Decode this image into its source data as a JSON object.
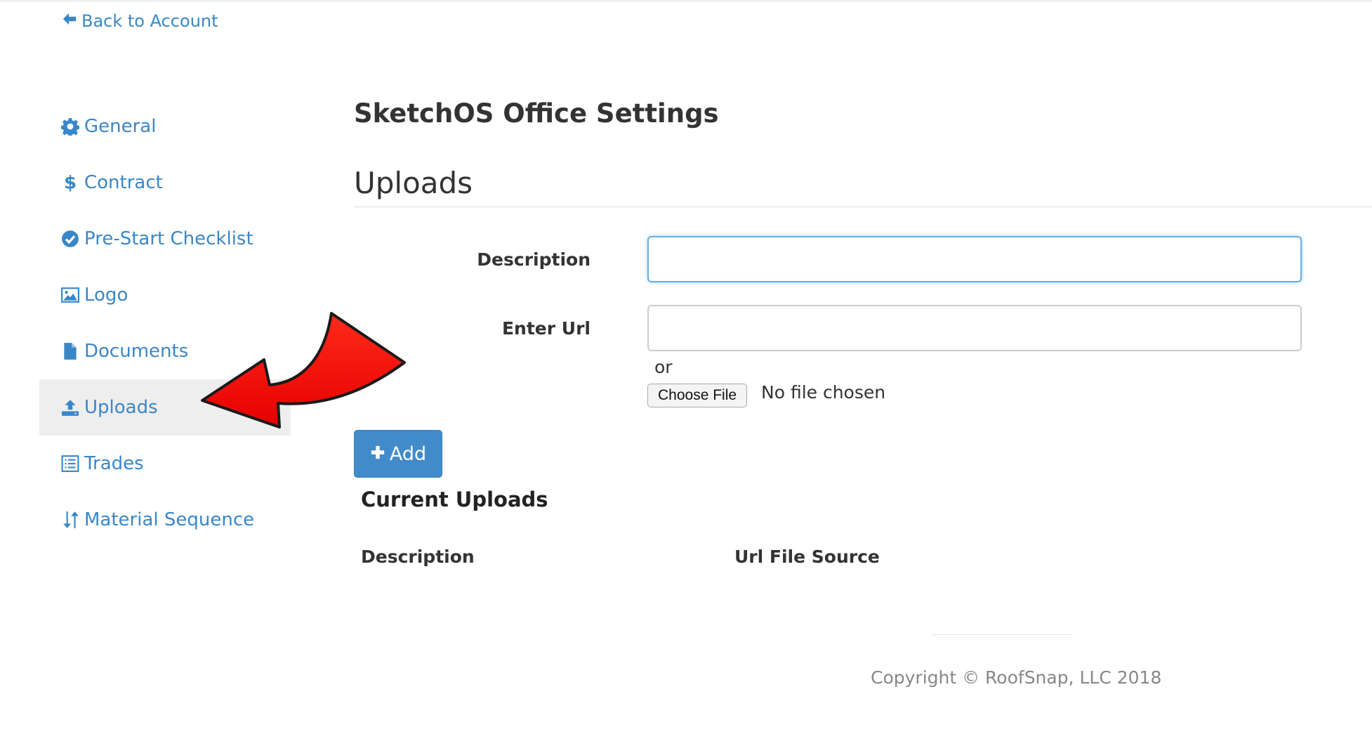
{
  "nav": {
    "back_label": "Back to Account"
  },
  "sidebar": {
    "items": [
      {
        "label": "General",
        "icon": "gear-icon"
      },
      {
        "label": "Contract",
        "icon": "dollar-icon"
      },
      {
        "label": "Pre-Start Checklist",
        "icon": "check-circle-icon"
      },
      {
        "label": "Logo",
        "icon": "image-icon"
      },
      {
        "label": "Documents",
        "icon": "file-icon"
      },
      {
        "label": "Uploads",
        "icon": "upload-icon",
        "active": true
      },
      {
        "label": "Trades",
        "icon": "list-icon"
      },
      {
        "label": "Material Sequence",
        "icon": "sort-icon"
      }
    ]
  },
  "main": {
    "page_title": "SketchOS Office Settings",
    "section_title": "Uploads",
    "form": {
      "description_label": "Description",
      "description_value": "",
      "url_label": "Enter Url",
      "url_value": "",
      "or_text": "or",
      "choose_file_label": "Choose File",
      "file_status": "No file chosen",
      "add_label": "Add"
    },
    "current_uploads": {
      "title": "Current Uploads",
      "columns": [
        "Description",
        "Url File Source"
      ]
    }
  },
  "footer": {
    "copyright": "Copyright © RoofSnap, LLC 2018"
  },
  "colors": {
    "link": "#3a87c8",
    "primary_button": "#428bca",
    "active_bg": "#eeeeee",
    "annotation_arrow": "#ff0000"
  }
}
